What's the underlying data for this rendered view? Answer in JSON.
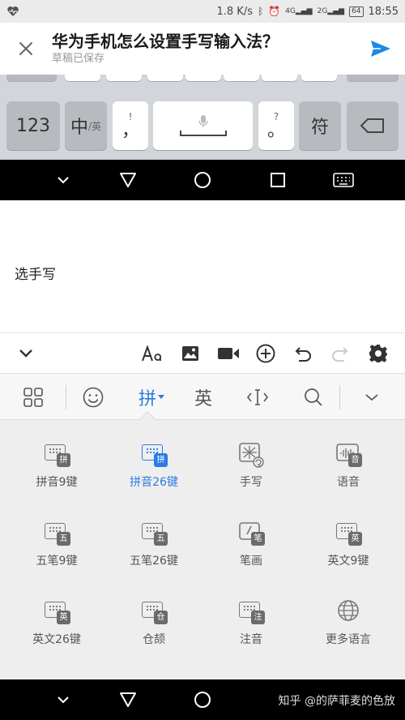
{
  "status_bar": {
    "speed": "1.8 K/s",
    "net1": "4G",
    "net2": "2G",
    "battery": "64",
    "time": "18:55"
  },
  "header": {
    "title": "华为手机怎么设置手写输入法？",
    "subtitle": "草稿已保存"
  },
  "keyboard": {
    "key_123": "123",
    "key_lang": "中",
    "key_lang_sub": "/英",
    "key_comma_top": "!",
    "key_comma": "，",
    "key_period_top": "?",
    "key_period": "。",
    "key_symbols": "符"
  },
  "content": {
    "text": "选手写"
  },
  "ime_bar": {
    "pinyin": "拼",
    "english": "英"
  },
  "input_methods": [
    {
      "label": "拼音9键",
      "badge": "拼"
    },
    {
      "label": "拼音26键",
      "badge": "拼",
      "selected": true
    },
    {
      "label": "手写",
      "badge": ""
    },
    {
      "label": "语音",
      "badge": "音"
    },
    {
      "label": "五笔9键",
      "badge": "五"
    },
    {
      "label": "五笔26键",
      "badge": "五"
    },
    {
      "label": "笔画",
      "badge": "笔"
    },
    {
      "label": "英文9键",
      "badge": "英"
    },
    {
      "label": "英文26键",
      "badge": "英"
    },
    {
      "label": "仓颉",
      "badge": "仓"
    },
    {
      "label": "注音",
      "badge": "注"
    },
    {
      "label": "更多语言",
      "badge": ""
    }
  ],
  "watermark": "知乎 @的萨菲麦的色放",
  "colors": {
    "accent": "#2a7be4",
    "send": "#1e88e5"
  }
}
